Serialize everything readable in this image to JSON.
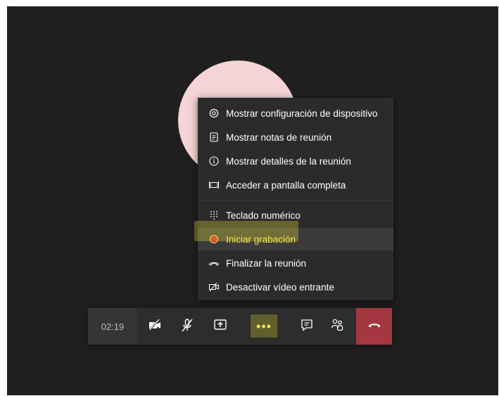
{
  "menu": {
    "items": [
      {
        "label": "Mostrar configuración de dispositivo",
        "icon": "gear-icon"
      },
      {
        "label": "Mostrar notas de reunión",
        "icon": "notes-icon"
      },
      {
        "label": "Mostrar detalles de la reunión",
        "icon": "info-icon"
      },
      {
        "label": "Acceder a pantalla completa",
        "icon": "fullscreen-icon"
      },
      {
        "label": "Teclado numérico",
        "icon": "dialpad-icon"
      },
      {
        "label": "Iniciar grabación",
        "icon": "record-icon"
      },
      {
        "label": "Finalizar la reunión",
        "icon": "end-call-icon"
      },
      {
        "label": "Desactivar vídeo entrante",
        "icon": "video-off-icon"
      }
    ]
  },
  "toolbar": {
    "timer": "02:19",
    "buttons": [
      "camera-off-icon",
      "mic-off-icon",
      "share-screen-icon",
      "more-options-icon",
      "chat-icon",
      "participants-icon",
      "hang-up-icon"
    ]
  },
  "colors": {
    "background": "#1f1f1f",
    "menu": "#2b2b2b",
    "highlight": "#f2e64c",
    "hangup": "#a4373f",
    "avatar": "#f5d3d6"
  }
}
